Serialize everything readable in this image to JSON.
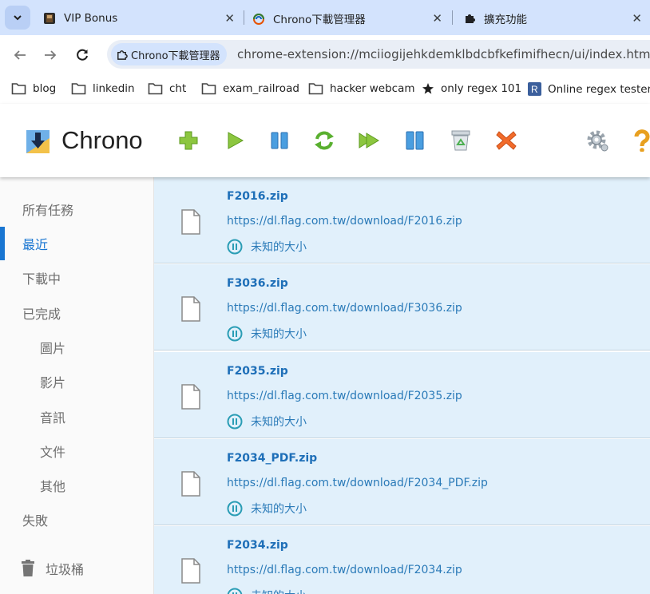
{
  "browser": {
    "tabs": [
      {
        "label": "VIP Bonus",
        "icon": "tiktok-favicon-icon"
      },
      {
        "label": "Chrono下載管理器",
        "icon": "chrono-favicon-icon"
      },
      {
        "label": "擴充功能",
        "icon": "puzzle-favicon-icon"
      }
    ],
    "close_glyph": "✕",
    "site_chip": "Chrono下載管理器",
    "url": "chrome-extension://mciiogijehkdemklbdcbfkefimifhecn/ui/index.htm",
    "bookmarks": [
      {
        "label": "blog",
        "icon": "folder-icon"
      },
      {
        "label": "linkedin",
        "icon": "folder-icon"
      },
      {
        "label": "cht",
        "icon": "folder-icon"
      },
      {
        "label": "exam_railroad",
        "icon": "folder-icon"
      },
      {
        "label": "hacker webcam",
        "icon": "folder-icon"
      },
      {
        "label": "only regex 101",
        "icon": "star-icon"
      },
      {
        "label": "Online regex tester...",
        "icon": "regexr-icon"
      }
    ]
  },
  "app": {
    "title": "Chrono",
    "toolbar": [
      "add",
      "start",
      "pause",
      "restart",
      "start-all",
      "pause-all",
      "clear-completed",
      "delete",
      "settings",
      "help"
    ],
    "colors": {
      "accent": "#1976d2",
      "item_bg": "#e1f0fb",
      "link": "#2a7ab8"
    }
  },
  "sidebar": {
    "items": [
      {
        "label": "所有任務",
        "sub": false,
        "active": false
      },
      {
        "label": "最近",
        "sub": false,
        "active": true
      },
      {
        "label": "下載中",
        "sub": false,
        "active": false
      },
      {
        "label": "已完成",
        "sub": false,
        "active": false
      },
      {
        "label": "圖片",
        "sub": true,
        "active": false
      },
      {
        "label": "影片",
        "sub": true,
        "active": false
      },
      {
        "label": "音訊",
        "sub": true,
        "active": false
      },
      {
        "label": "文件",
        "sub": true,
        "active": false
      },
      {
        "label": "其他",
        "sub": true,
        "active": false
      },
      {
        "label": "失敗",
        "sub": false,
        "active": false
      }
    ],
    "trash_label": "垃圾桶"
  },
  "downloads": [
    {
      "name": "F2016.zip",
      "url": "https://dl.flag.com.tw/download/F2016.zip",
      "status": "未知的大小"
    },
    {
      "name": "F3036.zip",
      "url": "https://dl.flag.com.tw/download/F3036.zip",
      "status": "未知的大小"
    },
    {
      "name": "F2035.zip",
      "url": "https://dl.flag.com.tw/download/F2035.zip",
      "status": "未知的大小"
    },
    {
      "name": "F2034_PDF.zip",
      "url": "https://dl.flag.com.tw/download/F2034_PDF.zip",
      "status": "未知的大小"
    },
    {
      "name": "F2034.zip",
      "url": "https://dl.flag.com.tw/download/F2034.zip",
      "status": "未知的大小"
    }
  ]
}
